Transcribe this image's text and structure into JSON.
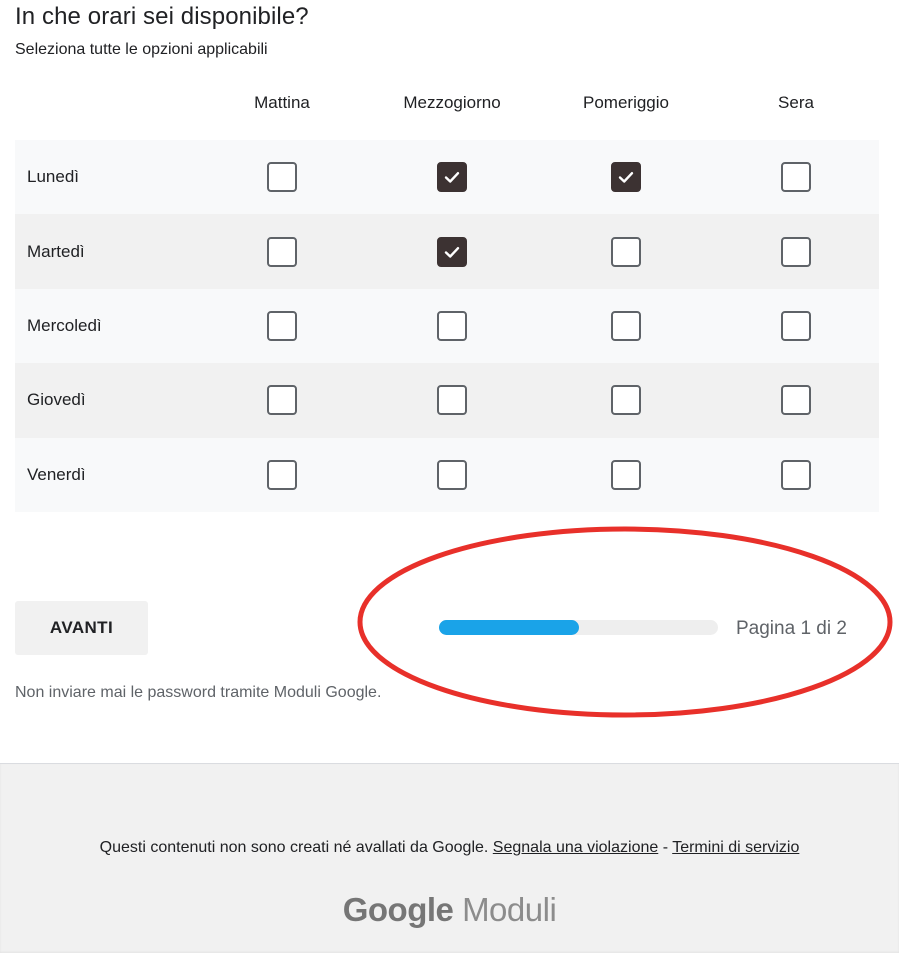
{
  "question": {
    "title": "In che orari sei disponibile?",
    "subtitle": "Seleziona tutte le opzioni applicabili"
  },
  "grid": {
    "columns": [
      "Mattina",
      "Mezzogiorno",
      "Pomeriggio",
      "Sera"
    ],
    "rows": [
      {
        "label": "Lunedì",
        "checked": [
          false,
          true,
          true,
          false
        ]
      },
      {
        "label": "Martedì",
        "checked": [
          false,
          true,
          false,
          false
        ]
      },
      {
        "label": "Mercoledì",
        "checked": [
          false,
          false,
          false,
          false
        ]
      },
      {
        "label": "Giovedì",
        "checked": [
          false,
          false,
          false,
          false
        ]
      },
      {
        "label": "Venerdì",
        "checked": [
          false,
          false,
          false,
          false
        ]
      }
    ]
  },
  "navigation": {
    "next_label": "AVANTI",
    "progress_fraction": 0.5,
    "page_text": "Pagina 1 di 2"
  },
  "warning": "Non inviare mai le password tramite Moduli Google.",
  "footer": {
    "disclaimer": "Questi contenuti non sono creati né avallati da Google.",
    "report_link": "Segnala una violazione",
    "separator": " - ",
    "terms_link": "Termini di servizio",
    "brand_google": "Google",
    "brand_product": "Moduli"
  },
  "colors": {
    "checked_fill": "#3c3232",
    "progress_fill": "#1aa3e8",
    "annotation": "#e8302a"
  },
  "icons": {
    "checkbox_checked": "check-icon"
  }
}
